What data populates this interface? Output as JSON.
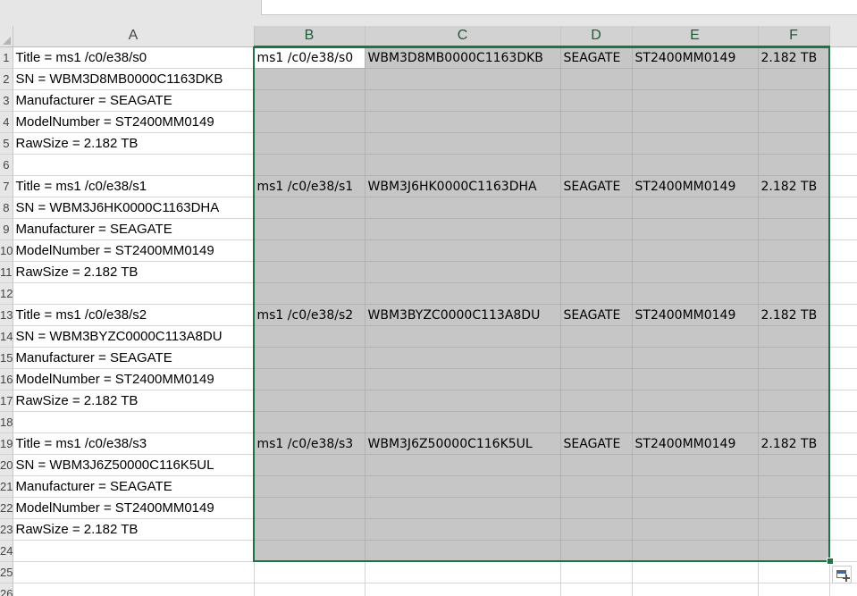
{
  "columns": [
    {
      "label": "A",
      "selected": false
    },
    {
      "label": "B",
      "selected": true
    },
    {
      "label": "C",
      "selected": true
    },
    {
      "label": "D",
      "selected": true
    },
    {
      "label": "E",
      "selected": true
    },
    {
      "label": "F",
      "selected": true
    }
  ],
  "rows": [
    {
      "num": "1",
      "a": "Title = ms1 /c0/e38/s0",
      "b": "ms1 /c0/e38/s0",
      "c": "WBM3D8MB0000C1163DKB",
      "d": "SEAGATE",
      "e": "ST2400MM0149",
      "f": "2.182 TB"
    },
    {
      "num": "2",
      "a": "SN = WBM3D8MB0000C1163DKB",
      "b": "",
      "c": "",
      "d": "",
      "e": "",
      "f": ""
    },
    {
      "num": "3",
      "a": "Manufacturer = SEAGATE",
      "b": "",
      "c": "",
      "d": "",
      "e": "",
      "f": ""
    },
    {
      "num": "4",
      "a": "ModelNumber = ST2400MM0149",
      "b": "",
      "c": "",
      "d": "",
      "e": "",
      "f": ""
    },
    {
      "num": "5",
      "a": "RawSize = 2.182 TB",
      "b": "",
      "c": "",
      "d": "",
      "e": "",
      "f": ""
    },
    {
      "num": "6",
      "a": "",
      "b": "",
      "c": "",
      "d": "",
      "e": "",
      "f": ""
    },
    {
      "num": "7",
      "a": "Title = ms1 /c0/e38/s1",
      "b": "ms1 /c0/e38/s1",
      "c": "WBM3J6HK0000C1163DHA",
      "d": "SEAGATE",
      "e": "ST2400MM0149",
      "f": "2.182 TB"
    },
    {
      "num": "8",
      "a": "SN = WBM3J6HK0000C1163DHA",
      "b": "",
      "c": "",
      "d": "",
      "e": "",
      "f": ""
    },
    {
      "num": "9",
      "a": "Manufacturer = SEAGATE",
      "b": "",
      "c": "",
      "d": "",
      "e": "",
      "f": ""
    },
    {
      "num": "10",
      "a": "ModelNumber = ST2400MM0149",
      "b": "",
      "c": "",
      "d": "",
      "e": "",
      "f": ""
    },
    {
      "num": "11",
      "a": "RawSize = 2.182 TB",
      "b": "",
      "c": "",
      "d": "",
      "e": "",
      "f": ""
    },
    {
      "num": "12",
      "a": "",
      "b": "",
      "c": "",
      "d": "",
      "e": "",
      "f": ""
    },
    {
      "num": "13",
      "a": "Title = ms1 /c0/e38/s2",
      "b": "ms1 /c0/e38/s2",
      "c": "WBM3BYZC0000C113A8DU",
      "d": "SEAGATE",
      "e": "ST2400MM0149",
      "f": "2.182 TB"
    },
    {
      "num": "14",
      "a": "SN = WBM3BYZC0000C113A8DU",
      "b": "",
      "c": "",
      "d": "",
      "e": "",
      "f": ""
    },
    {
      "num": "15",
      "a": "Manufacturer = SEAGATE",
      "b": "",
      "c": "",
      "d": "",
      "e": "",
      "f": ""
    },
    {
      "num": "16",
      "a": "ModelNumber = ST2400MM0149",
      "b": "",
      "c": "",
      "d": "",
      "e": "",
      "f": ""
    },
    {
      "num": "17",
      "a": "RawSize = 2.182 TB",
      "b": "",
      "c": "",
      "d": "",
      "e": "",
      "f": ""
    },
    {
      "num": "18",
      "a": "",
      "b": "",
      "c": "",
      "d": "",
      "e": "",
      "f": ""
    },
    {
      "num": "19",
      "a": "Title = ms1 /c0/e38/s3",
      "b": "ms1 /c0/e38/s3",
      "c": "WBM3J6Z50000C116K5UL",
      "d": "SEAGATE",
      "e": "ST2400MM0149",
      "f": "2.182 TB"
    },
    {
      "num": "20",
      "a": "SN = WBM3J6Z50000C116K5UL",
      "b": "",
      "c": "",
      "d": "",
      "e": "",
      "f": ""
    },
    {
      "num": "21",
      "a": "Manufacturer = SEAGATE",
      "b": "",
      "c": "",
      "d": "",
      "e": "",
      "f": ""
    },
    {
      "num": "22",
      "a": "ModelNumber = ST2400MM0149",
      "b": "",
      "c": "",
      "d": "",
      "e": "",
      "f": ""
    },
    {
      "num": "23",
      "a": "RawSize = 2.182 TB",
      "b": "",
      "c": "",
      "d": "",
      "e": "",
      "f": ""
    },
    {
      "num": "24",
      "a": "",
      "b": "",
      "c": "",
      "d": "",
      "e": "",
      "f": ""
    },
    {
      "num": "25",
      "a": "",
      "b": "",
      "c": "",
      "d": "",
      "e": "",
      "f": ""
    },
    {
      "num": "26",
      "a": "",
      "b": "",
      "c": "",
      "d": "",
      "e": "",
      "f": ""
    }
  ],
  "selection": {
    "range_start": "B1",
    "range_end": "F24",
    "active_cell": "B1"
  },
  "colors": {
    "selection_accent": "#217346",
    "selected_fill": "#c6c6c6",
    "header_bg": "#e6e6e6"
  },
  "icons": {
    "quick_analysis": "quick-analysis-icon",
    "select_all": "select-all-icon"
  }
}
